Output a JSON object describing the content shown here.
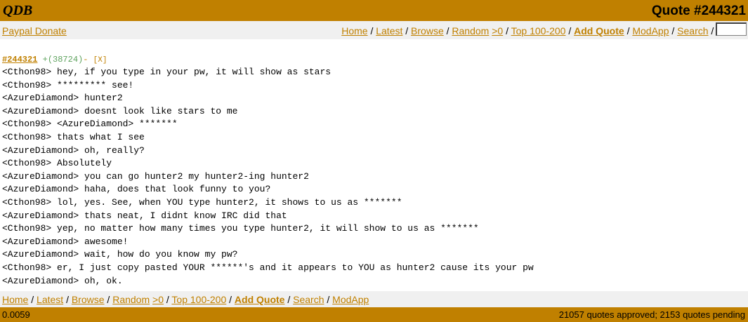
{
  "header": {
    "logo": "QDB",
    "title": "Quote #244321"
  },
  "nav": {
    "donate": "Paypal Donate",
    "links": {
      "home": "Home",
      "latest": "Latest",
      "browse": "Browse",
      "random": "Random",
      "random_pos": ">0",
      "top": "Top 100-200",
      "add_quote": "Add Quote",
      "modapp": "ModApp",
      "search": "Search",
      "hash": "#"
    },
    "jump_value": ""
  },
  "quote": {
    "id": "#244321",
    "plus": "+",
    "score": "(38724)",
    "minus": "-",
    "report": "[X]",
    "lines": [
      "<Cthon98> hey, if you type in your pw, it will show as stars",
      "<Cthon98> ********* see!",
      "<AzureDiamond> hunter2",
      "<AzureDiamond> doesnt look like stars to me",
      "<Cthon98> <AzureDiamond> *******",
      "<Cthon98> thats what I see",
      "<AzureDiamond> oh, really?",
      "<Cthon98> Absolutely",
      "<AzureDiamond> you can go hunter2 my hunter2-ing hunter2",
      "<AzureDiamond> haha, does that look funny to you?",
      "<Cthon98> lol, yes. See, when YOU type hunter2, it shows to us as *******",
      "<AzureDiamond> thats neat, I didnt know IRC did that",
      "<Cthon98> yep, no matter how many times you type hunter2, it will show to us as *******",
      "<AzureDiamond> awesome!",
      "<AzureDiamond> wait, how do you know my pw?",
      "<Cthon98> er, I just copy pasted YOUR ******'s and it appears to YOU as hunter2 cause its your pw",
      "<AzureDiamond> oh, ok."
    ]
  },
  "footer": {
    "timing": "0.0059",
    "stats": "21057 quotes approved; 2153 quotes pending"
  },
  "colors": {
    "brand": "#c08000",
    "bar": "#f0f0f0"
  }
}
